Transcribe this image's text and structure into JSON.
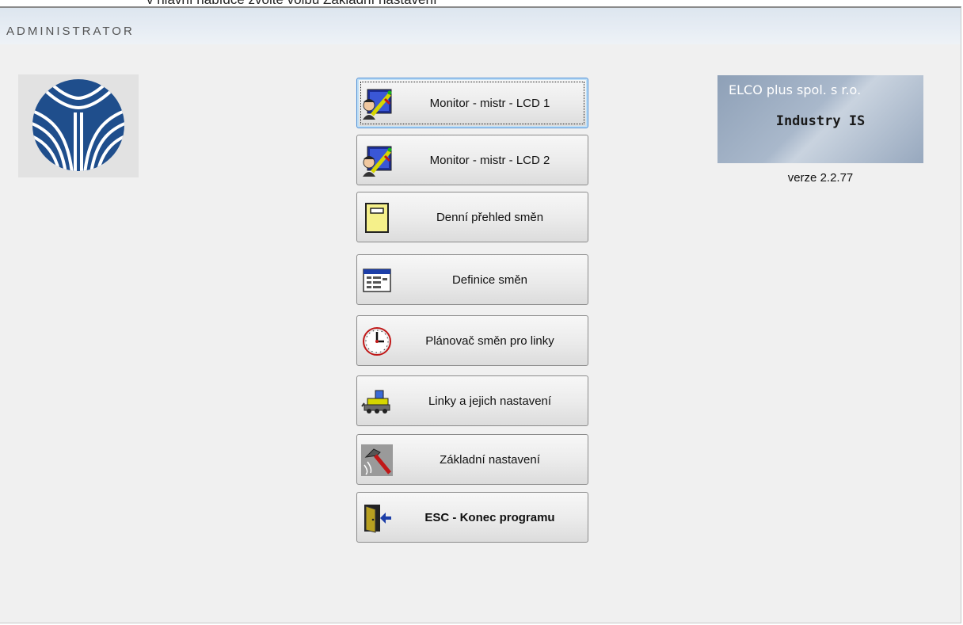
{
  "document_caption": "v hlavní nabídce zvolte volbu Základní nastavení",
  "window": {
    "title": "ADMINISTRATOR"
  },
  "menu": {
    "buttons": [
      {
        "label": "Monitor - mistr  - LCD  1",
        "icon": "worker-monitor-icon",
        "focused": true
      },
      {
        "label": "Monitor - mistr  - LCD  2",
        "icon": "worker-monitor-icon"
      },
      {
        "label": "Denní přehled směn",
        "icon": "notepad-icon"
      },
      {
        "label": "Definice směn",
        "icon": "table-window-icon"
      },
      {
        "label": "Plánovač směn pro linky",
        "icon": "clock-icon"
      },
      {
        "label": "Linky a jejich nastavení",
        "icon": "machine-line-icon"
      },
      {
        "label": "Základní nastavení",
        "icon": "hammer-icon"
      },
      {
        "label": "ESC - Konec  programu",
        "icon": "exit-door-icon",
        "bold": true
      }
    ]
  },
  "brand": {
    "company": "ELCO plus spol. s r.o.",
    "product": "Industry IS",
    "version": "verze 2.2.77"
  }
}
